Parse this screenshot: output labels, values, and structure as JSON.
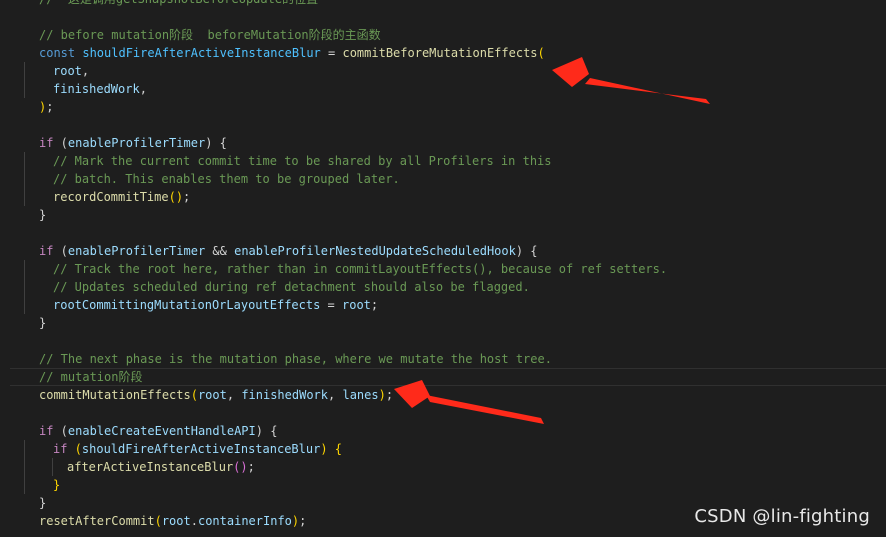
{
  "code": {
    "l0": "//  这是调用getSnapshotBeforeUpdate的位置",
    "l2": "// before mutation阶段  beforeMutation阶段的主函数",
    "l3": {
      "kw": "const",
      "name": "shouldFireAfterActiveInstanceBlur",
      "eq": " = ",
      "fn": "commitBeforeMutationEffects",
      "open": "("
    },
    "l4": {
      "arg": "root",
      "sep": ","
    },
    "l5": {
      "arg": "finishedWork",
      "sep": ","
    },
    "l6": {
      "close": ")",
      "semi": ";"
    },
    "l8": {
      "kw": "if",
      "open": " (",
      "cond": "enableProfilerTimer",
      "close": ") {"
    },
    "l9": "// Mark the current commit time to be shared by all Profilers in this",
    "l10": "// batch. This enables them to be grouped later.",
    "l11": {
      "fn": "recordCommitTime",
      "call": "()",
      "semi": ";"
    },
    "l12": "}",
    "l14": {
      "kw": "if",
      "open": " (",
      "cond1": "enableProfilerTimer",
      "op": " && ",
      "cond2": "enableProfilerNestedUpdateScheduledHook",
      "close": ") {"
    },
    "l15": "// Track the root here, rather than in commitLayoutEffects(), because of ref setters.",
    "l16": "// Updates scheduled during ref detachment should also be flagged.",
    "l17": {
      "lhs": "rootCommittingMutationOrLayoutEffects",
      "eq": " = ",
      "rhs": "root",
      "semi": ";"
    },
    "l18": "}",
    "l20": "// The next phase is the mutation phase, where we mutate the host tree.",
    "l21": "// mutation阶段",
    "l22": {
      "fn": "commitMutationEffects",
      "open": "(",
      "a1": "root",
      "s1": ", ",
      "a2": "finishedWork",
      "s2": ", ",
      "a3": "lanes",
      "close": ")",
      "semi": ";"
    },
    "l24": {
      "kw": "if",
      "open": " (",
      "cond": "enableCreateEventHandleAPI",
      "close": ") {"
    },
    "l25": {
      "kw": "if",
      "open": " (",
      "cond": "shouldFireAfterActiveInstanceBlur",
      "close": ") {"
    },
    "l26": {
      "fn": "afterActiveInstanceBlur",
      "call": "()",
      "semi": ";"
    },
    "l27": "}",
    "l28": "}",
    "l29": {
      "fn": "resetAfterCommit",
      "open": "(",
      "obj": "root",
      "dot": ".",
      "prop": "containerInfo",
      "close": ")",
      "semi": ";"
    }
  },
  "watermark": "CSDN @lin-fighting",
  "colors": {
    "background": "#1e1e1e",
    "comment": "#6a9955",
    "keyword": "#569cd6",
    "control": "#c586c0",
    "function": "#dcdcaa",
    "constant": "#4fc1ff",
    "variable": "#9cdcfe",
    "arrow": "#ff2a1a"
  }
}
